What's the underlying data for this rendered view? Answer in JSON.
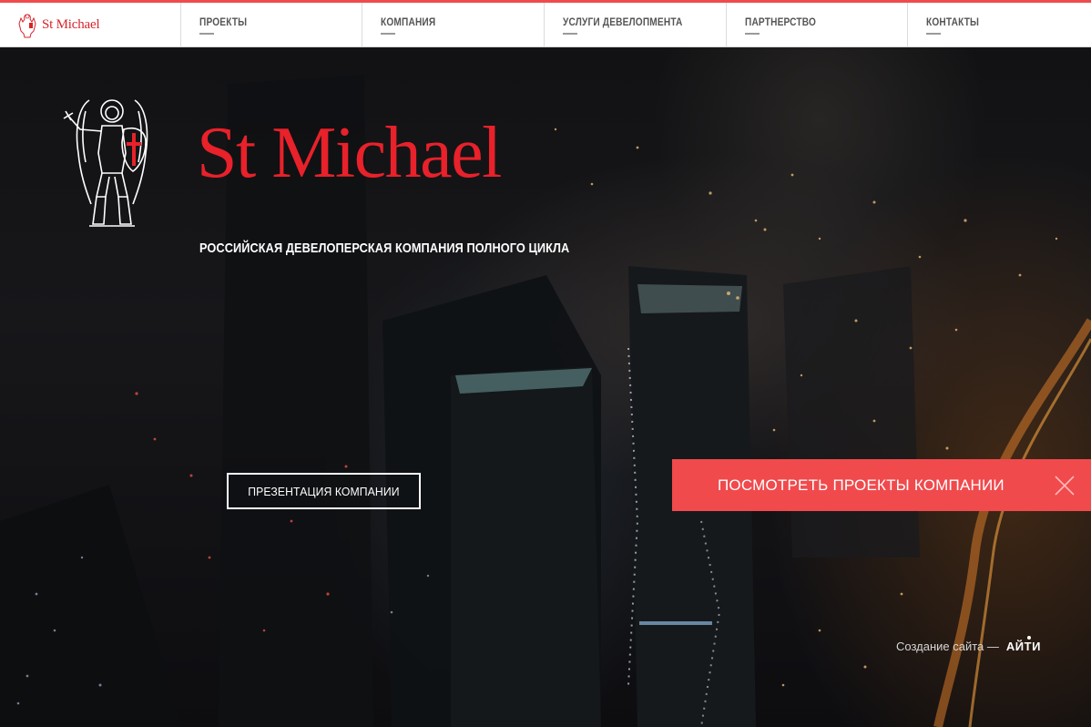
{
  "header": {
    "brand_label": "St Michael",
    "nav": [
      {
        "label": "ПРОЕКТЫ"
      },
      {
        "label": "КОМПАНИЯ"
      },
      {
        "label": "УСЛУГИ ДЕВЕЛОПМЕНТА"
      },
      {
        "label": "ПАРТНЕРСТВО"
      },
      {
        "label": "КОНТАКТЫ"
      }
    ]
  },
  "hero": {
    "title": "St Michael",
    "tagline": "РОССИЙСКАЯ ДЕВЕЛОПЕРСКАЯ КОМПАНИЯ ПОЛНОГО ЦИКЛА",
    "presentation_button": "ПРЕЗЕНТАЦИЯ КОМПАНИИ",
    "projects_banner": "ПОСМОТРЕТЬ ПРОЕКТЫ КОМПАНИИ"
  },
  "credit": {
    "text": "Создание сайта —",
    "brand": "АЙТИ"
  },
  "colors": {
    "accent_red": "#f04a4d",
    "logo_red": "#e8212a",
    "nav_text": "#555555",
    "background": "#0b0b0e"
  },
  "icons": [
    "angel-logo-icon",
    "close-icon"
  ]
}
